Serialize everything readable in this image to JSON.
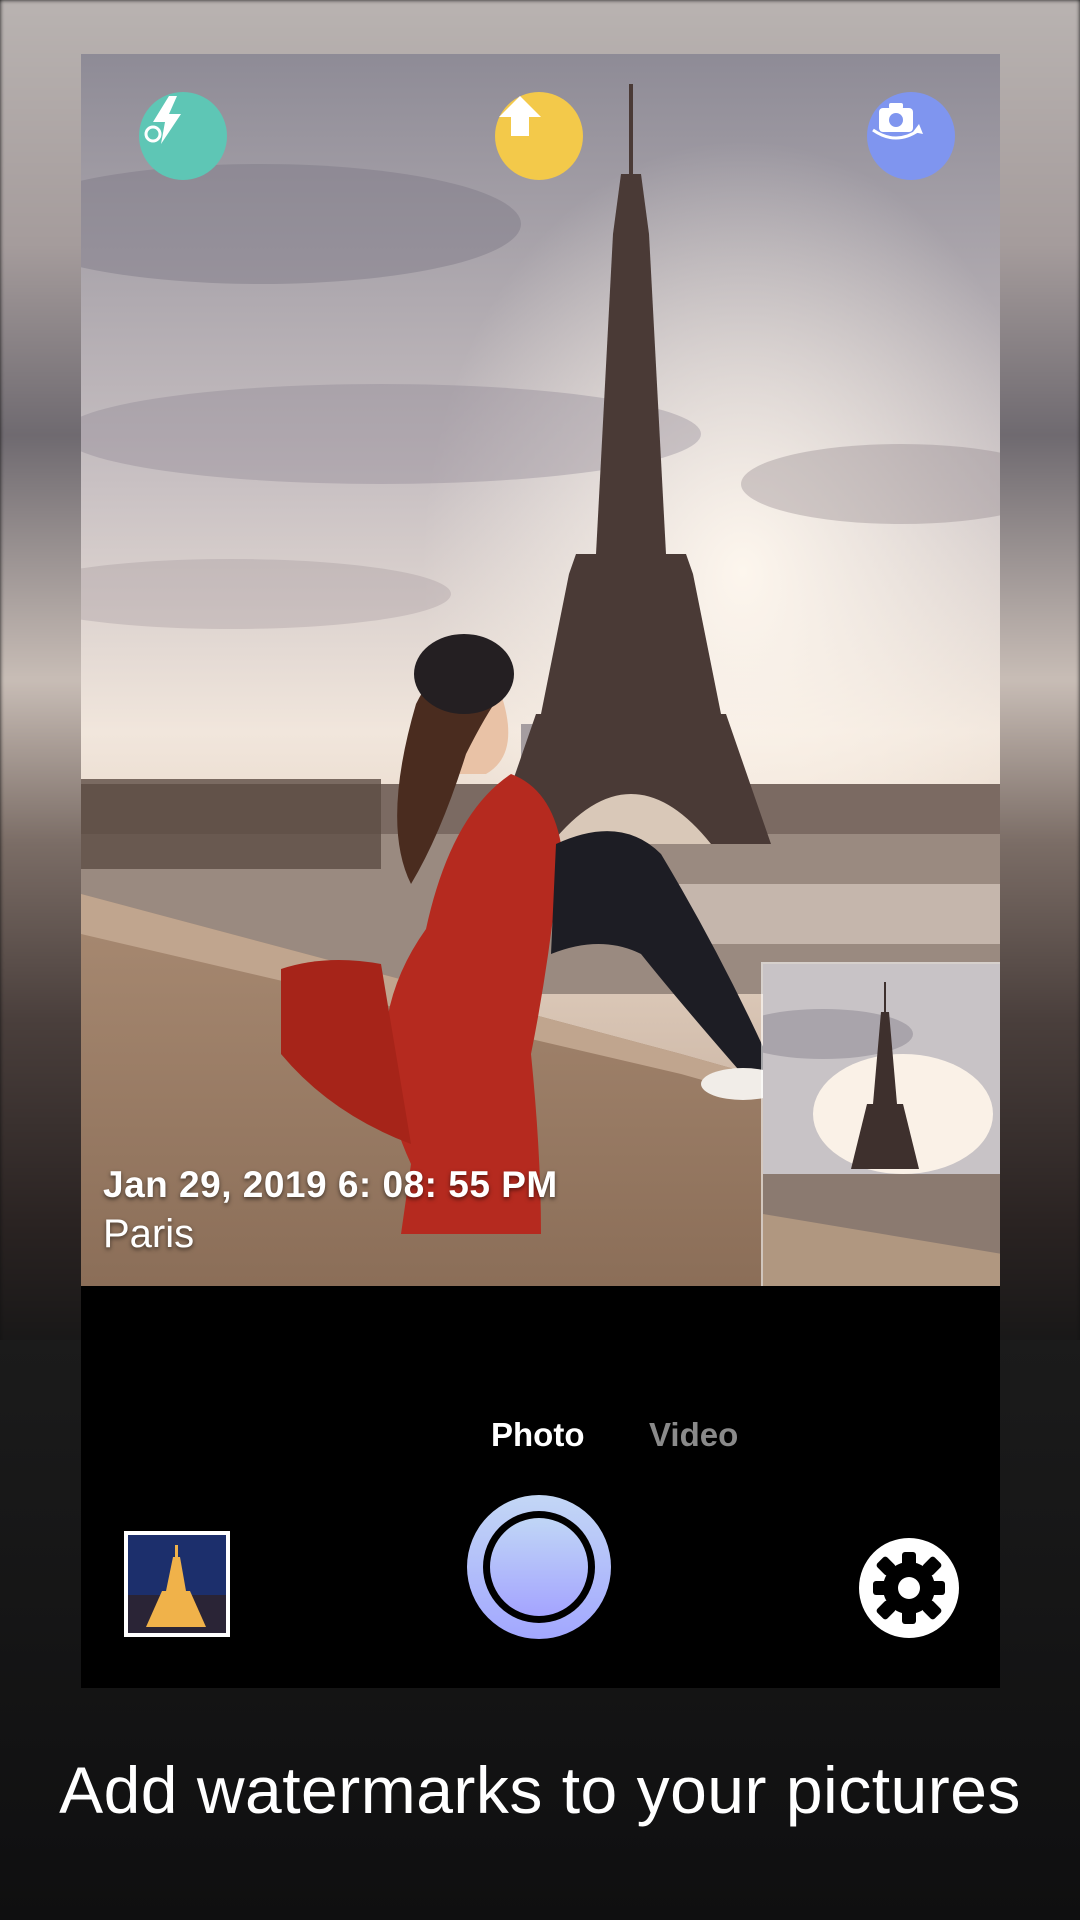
{
  "viewfinder": {
    "watermark_date": "Jan 29, 2019  6: 08: 55 PM",
    "watermark_location": "Paris"
  },
  "top_bar": {
    "flash_icon": "auto-flash-icon",
    "upload_icon": "upload-arrow-icon",
    "switch_icon": "switch-camera-icon"
  },
  "modes": {
    "photo": "Photo",
    "video": "Video",
    "selected": "Photo"
  },
  "bottom_bar": {
    "gallery_icon": "gallery-thumbnail",
    "shutter_icon": "shutter-button",
    "settings_icon": "gear-icon"
  },
  "caption": "Add watermarks to your pictures",
  "colors": {
    "flash_button": "#5ec6b5",
    "upload_button": "#f3c94a",
    "switch_button": "#7f95ef",
    "shutter_gradient_top": "#c3d7f5",
    "shutter_gradient_bottom": "#a2a7ff",
    "inactive_mode": "#8a8a8a"
  }
}
